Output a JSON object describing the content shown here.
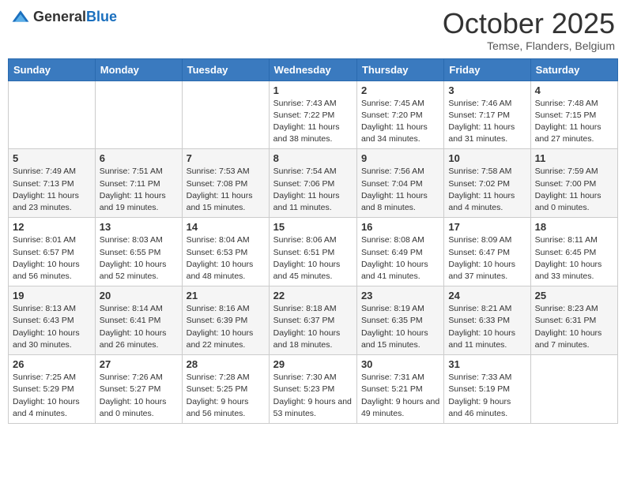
{
  "logo": {
    "general": "General",
    "blue": "Blue"
  },
  "header": {
    "month": "October 2025",
    "location": "Temse, Flanders, Belgium"
  },
  "weekdays": [
    "Sunday",
    "Monday",
    "Tuesday",
    "Wednesday",
    "Thursday",
    "Friday",
    "Saturday"
  ],
  "weeks": [
    [
      {
        "day": "",
        "info": ""
      },
      {
        "day": "",
        "info": ""
      },
      {
        "day": "",
        "info": ""
      },
      {
        "day": "1",
        "info": "Sunrise: 7:43 AM\nSunset: 7:22 PM\nDaylight: 11 hours and 38 minutes."
      },
      {
        "day": "2",
        "info": "Sunrise: 7:45 AM\nSunset: 7:20 PM\nDaylight: 11 hours and 34 minutes."
      },
      {
        "day": "3",
        "info": "Sunrise: 7:46 AM\nSunset: 7:17 PM\nDaylight: 11 hours and 31 minutes."
      },
      {
        "day": "4",
        "info": "Sunrise: 7:48 AM\nSunset: 7:15 PM\nDaylight: 11 hours and 27 minutes."
      }
    ],
    [
      {
        "day": "5",
        "info": "Sunrise: 7:49 AM\nSunset: 7:13 PM\nDaylight: 11 hours and 23 minutes."
      },
      {
        "day": "6",
        "info": "Sunrise: 7:51 AM\nSunset: 7:11 PM\nDaylight: 11 hours and 19 minutes."
      },
      {
        "day": "7",
        "info": "Sunrise: 7:53 AM\nSunset: 7:08 PM\nDaylight: 11 hours and 15 minutes."
      },
      {
        "day": "8",
        "info": "Sunrise: 7:54 AM\nSunset: 7:06 PM\nDaylight: 11 hours and 11 minutes."
      },
      {
        "day": "9",
        "info": "Sunrise: 7:56 AM\nSunset: 7:04 PM\nDaylight: 11 hours and 8 minutes."
      },
      {
        "day": "10",
        "info": "Sunrise: 7:58 AM\nSunset: 7:02 PM\nDaylight: 11 hours and 4 minutes."
      },
      {
        "day": "11",
        "info": "Sunrise: 7:59 AM\nSunset: 7:00 PM\nDaylight: 11 hours and 0 minutes."
      }
    ],
    [
      {
        "day": "12",
        "info": "Sunrise: 8:01 AM\nSunset: 6:57 PM\nDaylight: 10 hours and 56 minutes."
      },
      {
        "day": "13",
        "info": "Sunrise: 8:03 AM\nSunset: 6:55 PM\nDaylight: 10 hours and 52 minutes."
      },
      {
        "day": "14",
        "info": "Sunrise: 8:04 AM\nSunset: 6:53 PM\nDaylight: 10 hours and 48 minutes."
      },
      {
        "day": "15",
        "info": "Sunrise: 8:06 AM\nSunset: 6:51 PM\nDaylight: 10 hours and 45 minutes."
      },
      {
        "day": "16",
        "info": "Sunrise: 8:08 AM\nSunset: 6:49 PM\nDaylight: 10 hours and 41 minutes."
      },
      {
        "day": "17",
        "info": "Sunrise: 8:09 AM\nSunset: 6:47 PM\nDaylight: 10 hours and 37 minutes."
      },
      {
        "day": "18",
        "info": "Sunrise: 8:11 AM\nSunset: 6:45 PM\nDaylight: 10 hours and 33 minutes."
      }
    ],
    [
      {
        "day": "19",
        "info": "Sunrise: 8:13 AM\nSunset: 6:43 PM\nDaylight: 10 hours and 30 minutes."
      },
      {
        "day": "20",
        "info": "Sunrise: 8:14 AM\nSunset: 6:41 PM\nDaylight: 10 hours and 26 minutes."
      },
      {
        "day": "21",
        "info": "Sunrise: 8:16 AM\nSunset: 6:39 PM\nDaylight: 10 hours and 22 minutes."
      },
      {
        "day": "22",
        "info": "Sunrise: 8:18 AM\nSunset: 6:37 PM\nDaylight: 10 hours and 18 minutes."
      },
      {
        "day": "23",
        "info": "Sunrise: 8:19 AM\nSunset: 6:35 PM\nDaylight: 10 hours and 15 minutes."
      },
      {
        "day": "24",
        "info": "Sunrise: 8:21 AM\nSunset: 6:33 PM\nDaylight: 10 hours and 11 minutes."
      },
      {
        "day": "25",
        "info": "Sunrise: 8:23 AM\nSunset: 6:31 PM\nDaylight: 10 hours and 7 minutes."
      }
    ],
    [
      {
        "day": "26",
        "info": "Sunrise: 7:25 AM\nSunset: 5:29 PM\nDaylight: 10 hours and 4 minutes."
      },
      {
        "day": "27",
        "info": "Sunrise: 7:26 AM\nSunset: 5:27 PM\nDaylight: 10 hours and 0 minutes."
      },
      {
        "day": "28",
        "info": "Sunrise: 7:28 AM\nSunset: 5:25 PM\nDaylight: 9 hours and 56 minutes."
      },
      {
        "day": "29",
        "info": "Sunrise: 7:30 AM\nSunset: 5:23 PM\nDaylight: 9 hours and 53 minutes."
      },
      {
        "day": "30",
        "info": "Sunrise: 7:31 AM\nSunset: 5:21 PM\nDaylight: 9 hours and 49 minutes."
      },
      {
        "day": "31",
        "info": "Sunrise: 7:33 AM\nSunset: 5:19 PM\nDaylight: 9 hours and 46 minutes."
      },
      {
        "day": "",
        "info": ""
      }
    ]
  ]
}
